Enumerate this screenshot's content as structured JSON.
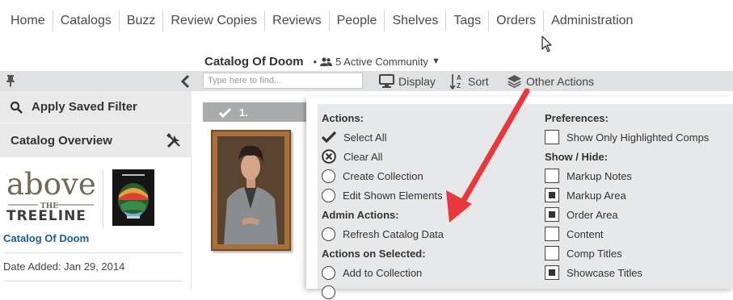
{
  "nav": {
    "items": [
      {
        "label": "Home"
      },
      {
        "label": "Catalogs"
      },
      {
        "label": "Buzz"
      },
      {
        "label": "Review Copies"
      },
      {
        "label": "Reviews"
      },
      {
        "label": "People"
      },
      {
        "label": "Shelves"
      },
      {
        "label": "Tags"
      },
      {
        "label": "Orders"
      },
      {
        "label": "Administration"
      }
    ]
  },
  "catalog": {
    "title": "Catalog Of Doom",
    "community_prefix": "•",
    "community": "5 Active Community"
  },
  "toolbar": {
    "search_placeholder": "Type here to find...",
    "display_label": "Display",
    "sort_label": "Sort",
    "other_actions_label": "Other Actions"
  },
  "left_panel": {
    "apply_filter_label": "Apply Saved Filter",
    "overview_title": "Catalog Overview",
    "logo": {
      "line1": "above",
      "line2": "THE",
      "line3": "TREELINE"
    },
    "catalog_link": "Catalog Of Doom",
    "date_added": "Date Added: Jan 29, 2014"
  },
  "comp": {
    "number": "1."
  },
  "dropdown": {
    "actions_title": "Actions:",
    "select_all": "Select All",
    "clear_all": "Clear All",
    "create_collection": "Create Collection",
    "edit_shown": "Edit Shown Elements",
    "admin_title": "Admin Actions:",
    "refresh_catalog": "Refresh Catalog Data",
    "selected_title": "Actions on Selected:",
    "add_collection": "Add to Collection",
    "preferences_title": "Preferences:",
    "show_highlighted": "Show Only Highlighted Comps",
    "show_hide_title": "Show / Hide:",
    "toggles": [
      {
        "label": "Markup Notes",
        "checked": false
      },
      {
        "label": "Markup Area",
        "checked": true
      },
      {
        "label": "Order Area",
        "checked": true
      },
      {
        "label": "Content",
        "checked": false
      },
      {
        "label": "Comp Titles",
        "checked": false
      },
      {
        "label": "Showcase Titles",
        "checked": true
      }
    ]
  },
  "colors": {
    "toolbar_bg": "#dfe1e2",
    "link": "#1a5d8f",
    "arrow": "#e8383d"
  }
}
